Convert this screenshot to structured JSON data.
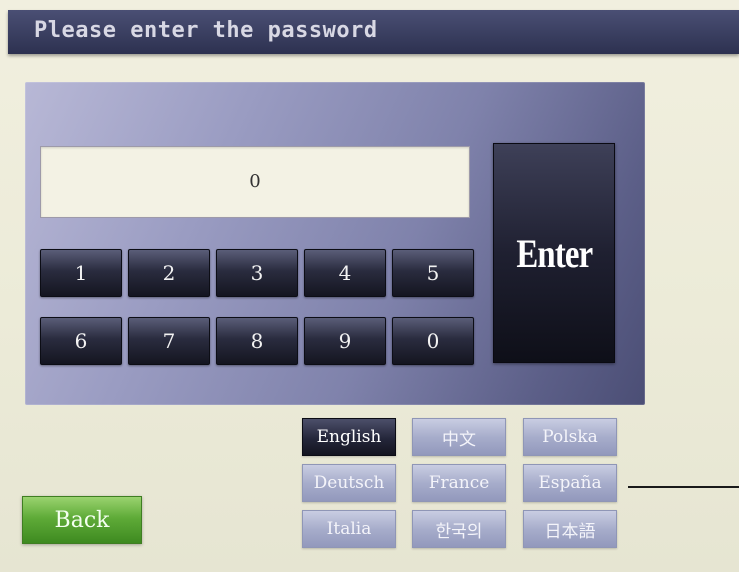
{
  "title": "Please enter the password",
  "password_display": "0",
  "keys": [
    "1",
    "2",
    "3",
    "4",
    "5",
    "6",
    "7",
    "8",
    "9",
    "0"
  ],
  "enter_label": "Enter",
  "languages": [
    "English",
    "中文",
    "Polska",
    "Deutsch",
    "France",
    "España",
    "Italia",
    "한국의",
    "日本語"
  ],
  "selected_language": "English",
  "back_label": "Back",
  "colors": {
    "title_bar": "#2d3150",
    "key_dark": "#141520",
    "back_green": "#5fab38",
    "background": "#f1efdf"
  }
}
